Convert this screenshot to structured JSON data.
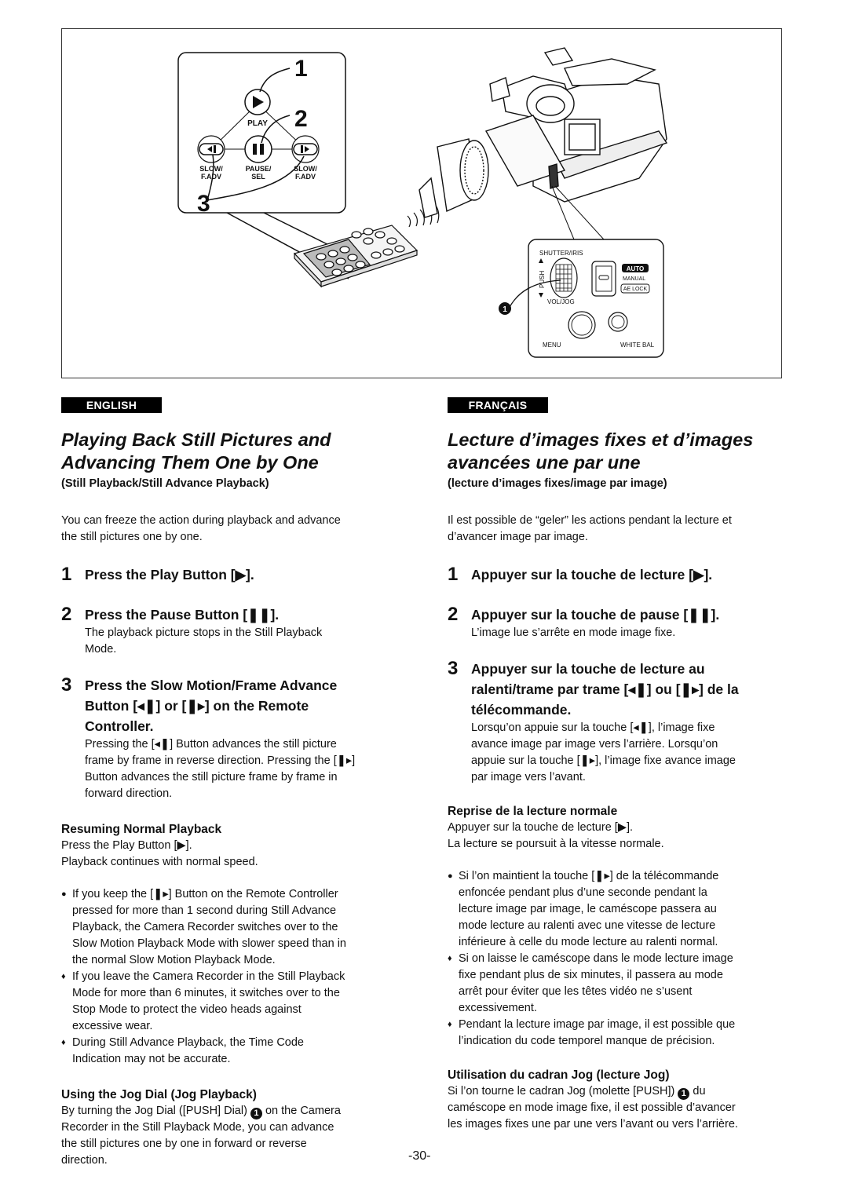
{
  "figure": {
    "callout_numbers": [
      "1",
      "2",
      "3"
    ],
    "remote_buttons": {
      "play_label": "PLAY",
      "slow_rev_label": [
        "SLOW/",
        "F.ADV"
      ],
      "pause_label": [
        "PAUSE/",
        "SEL"
      ],
      "slow_fwd_label": [
        "SLOW/",
        "F.ADV"
      ]
    },
    "camera_panel": {
      "shutter_iris": "SHUTTER/IRIS",
      "push": "PUSH",
      "vol_jog": "VOL/JOG",
      "auto": "AUTO",
      "manual": "MANUAL",
      "ae_lock": "AE LOCK",
      "menu": "MENU",
      "white_bal": "WHITE BAL",
      "marker": "1"
    }
  },
  "english": {
    "lang_tag": "ENGLISH",
    "title_line1": "Playing Back Still Pictures and",
    "title_line2": "Advancing Them One by One",
    "subtitle": "(Still Playback/Still Advance Playback)",
    "intro_line1": "You can freeze the action during playback and advance",
    "intro_line2": "the still pictures one by one.",
    "steps": [
      {
        "num": "1",
        "title": "Press the Play Button [▶]."
      },
      {
        "num": "2",
        "title": "Press the Pause Button [❚❚].",
        "desc": [
          "The playback picture stops in the Still Playback",
          "Mode."
        ]
      },
      {
        "num": "3",
        "title_lines": [
          "Press the Slow Motion/Frame Advance",
          "Button [◂❚] or [❚▸] on the Remote",
          "Controller."
        ],
        "desc": [
          "Pressing the [◂❚] Button advances the still picture",
          "frame by frame in reverse direction. Pressing the [❚▸]",
          "Button advances the still picture frame by frame in",
          "forward direction."
        ]
      }
    ],
    "resume": {
      "heading": "Resuming Normal Playback",
      "lines": [
        "Press the Play Button [▶].",
        "Playback continues with normal speed."
      ]
    },
    "notes": [
      {
        "marker": "●",
        "lines": [
          "If you keep the [❚▸] Button on the Remote Controller",
          "pressed for more than 1 second during Still Advance",
          "Playback, the Camera Recorder switches over to the",
          "Slow Motion Playback Mode with slower speed than in",
          "the normal Slow Motion Playback Mode."
        ]
      },
      {
        "marker": "♦",
        "lines": [
          "If you leave the Camera Recorder in the Still Playback",
          "Mode for more than 6 minutes, it switches over to the",
          "Stop Mode to protect the video heads against",
          "excessive wear."
        ]
      },
      {
        "marker": "♦",
        "lines": [
          "During Still Advance Playback, the Time Code",
          "Indication may not be accurate."
        ]
      }
    ],
    "jog": {
      "heading": "Using the Jog Dial (Jog Playback)",
      "line1_pre": "By turning the Jog Dial ([PUSH] Dial) ",
      "line1_marker": "1",
      "line1_post": " on the Camera",
      "lines": [
        "Recorder in the Still Playback Mode, you can advance",
        "the still pictures one by one in forward or reverse",
        "direction."
      ]
    }
  },
  "french": {
    "lang_tag": "FRANÇAIS",
    "title_line1": "Lecture d’images fixes et d’images",
    "title_line2": "avancées une par une",
    "subtitle": "(lecture d’images fixes/image par image)",
    "intro_line1": "Il est possible de “geler” les actions pendant la lecture et",
    "intro_line2": "d’avancer image par image.",
    "steps": [
      {
        "num": "1",
        "title": "Appuyer sur la touche de lecture [▶]."
      },
      {
        "num": "2",
        "title": "Appuyer sur la touche de pause [❚❚].",
        "desc": [
          "L’image lue s’arrête en mode image fixe."
        ]
      },
      {
        "num": "3",
        "title_lines": [
          "Appuyer sur la touche de lecture au",
          "ralenti/trame par trame [◂❚] ou [❚▸] de la",
          "télécommande."
        ],
        "desc": [
          "Lorsqu’on appuie sur la touche [◂❚], l’image fixe",
          "avance image par image vers l’arrière. Lorsqu’on",
          "appuie sur la touche [❚▸], l’image fixe avance image",
          "par image vers l’avant."
        ]
      }
    ],
    "resume": {
      "heading": "Reprise de la lecture normale",
      "lines": [
        "Appuyer sur la touche de lecture [▶].",
        "La lecture se poursuit à la vitesse normale."
      ]
    },
    "notes": [
      {
        "marker": "●",
        "lines": [
          "Si l’on maintient la touche [❚▸] de la télécommande",
          "enfoncée pendant plus d’une seconde pendant la",
          "lecture image par image, le caméscope passera au",
          "mode lecture au ralenti avec une vitesse de lecture",
          "inférieure à celle du mode lecture au ralenti normal."
        ]
      },
      {
        "marker": "♦",
        "lines": [
          "Si on laisse le caméscope dans le mode lecture image",
          "fixe pendant plus de six minutes, il passera au mode",
          "arrêt pour éviter que les têtes vidéo ne s’usent",
          "excessivement."
        ]
      },
      {
        "marker": "♦",
        "lines": [
          "Pendant la lecture image par image, il est possible que",
          "l’indication du code temporel manque de précision."
        ]
      }
    ],
    "jog": {
      "heading": "Utilisation du cadran Jog (lecture Jog)",
      "line1_pre": "Si l’on tourne le cadran Jog (molette [PUSH]) ",
      "line1_marker": "1",
      "line1_post": " du",
      "lines": [
        "caméscope en mode image fixe, il est possible d’avancer",
        "les images fixes une par une vers l’avant ou vers l’arrière."
      ]
    }
  },
  "page_number": "-30-"
}
